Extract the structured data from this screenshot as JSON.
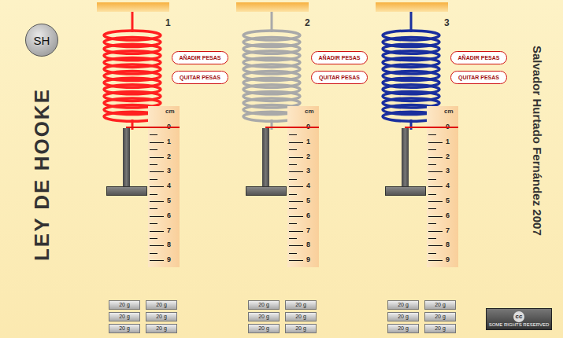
{
  "title": "LEY DE HOOKE",
  "logo": "SH",
  "author": "Salvador Hurtado Fernández 2007",
  "license": {
    "symbol": "cc",
    "text": "SOME RIGHTS RESERVED"
  },
  "springs": [
    {
      "number": "1",
      "color": "#ff2020",
      "buttons": [
        "AÑADIR PESAS",
        "QUITAR PESAS"
      ],
      "unit": "cm",
      "ticks": [
        "0",
        "1",
        "2",
        "3",
        "4",
        "5",
        "6",
        "7",
        "8",
        "9"
      ],
      "weights": [
        "20 g",
        "20 g",
        "20 g",
        "20 g",
        "20 g",
        "20 g"
      ]
    },
    {
      "number": "2",
      "color": "#a9a9a9",
      "buttons": [
        "AÑADIR PESAS",
        "QUITAR PESAS"
      ],
      "unit": "cm",
      "ticks": [
        "0",
        "1",
        "2",
        "3",
        "4",
        "5",
        "6",
        "7",
        "8",
        "9"
      ],
      "weights": [
        "20 g",
        "20 g",
        "20 g",
        "20 g",
        "20 g",
        "20 g"
      ]
    },
    {
      "number": "3",
      "color": "#1a2f9e",
      "buttons": [
        "AÑADIR PESAS",
        "QUITAR PESAS"
      ],
      "unit": "cm",
      "ticks": [
        "0",
        "1",
        "2",
        "3",
        "4",
        "5",
        "6",
        "7",
        "8",
        "9"
      ],
      "weights": [
        "20 g",
        "20 g",
        "20 g",
        "20 g",
        "20 g",
        "20 g"
      ]
    }
  ]
}
